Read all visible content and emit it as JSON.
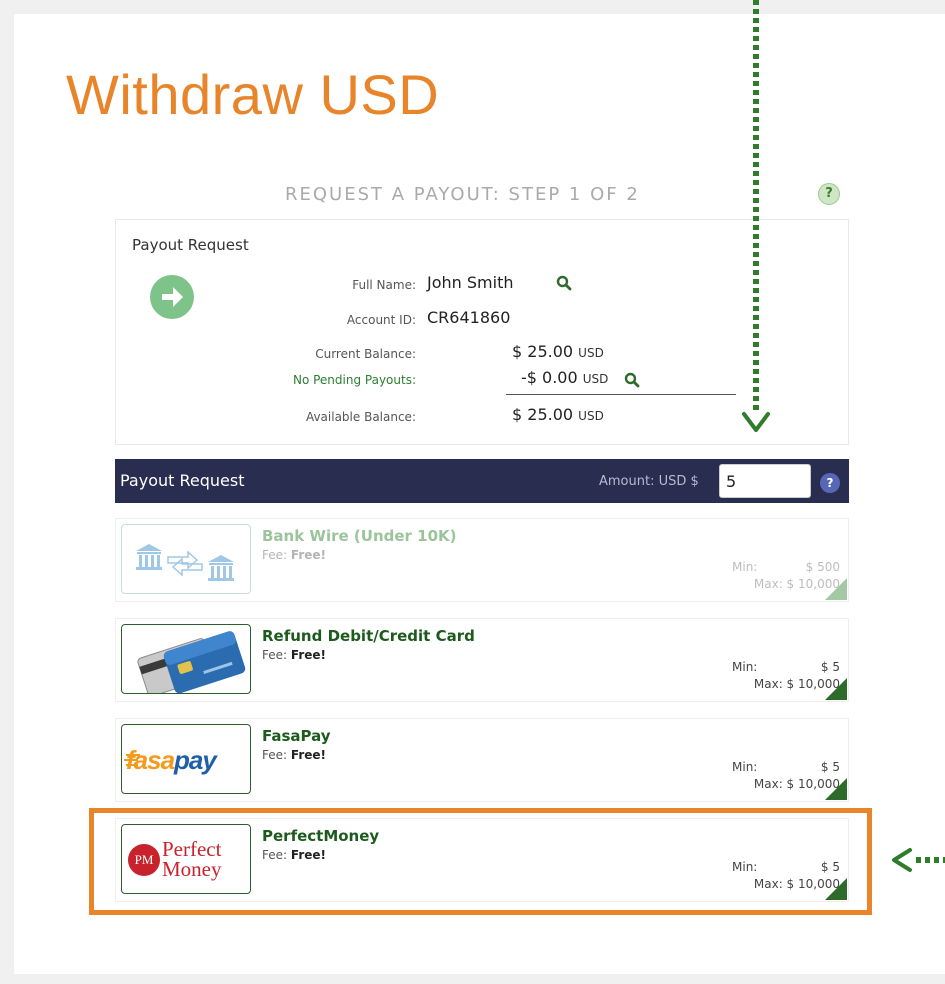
{
  "page": {
    "title": "Withdraw USD",
    "step_label": "REQUEST A PAYOUT: STEP 1 OF 2",
    "help_glyph": "?"
  },
  "summary": {
    "heading": "Payout Request",
    "full_name_label": "Full Name:",
    "full_name": "John Smith",
    "account_id_label": "Account ID:",
    "account_id": "CR641860",
    "current_balance_label": "Current Balance:",
    "current_balance": "$ 25.00",
    "pending_label": "No Pending Payouts:",
    "pending_value": "-$ 0.00",
    "available_label": "Available Balance:",
    "available_balance": "$ 25.00",
    "currency": "USD"
  },
  "payout_bar": {
    "label": "Payout Request",
    "amount_label": "Amount:  USD $",
    "amount_value": "5",
    "help_glyph": "?"
  },
  "methods": [
    {
      "name": "Bank Wire (Under 10K)",
      "fee_label": "Fee:",
      "fee_value": "Free!",
      "min_label": "Min:",
      "min_value": "$ 500",
      "max_label": "Max: $ 10,000",
      "logo": "bank-wire-logo",
      "enabled": false
    },
    {
      "name": "Refund Debit/Credit Card",
      "fee_label": "Fee:",
      "fee_value": "Free!",
      "min_label": "Min:",
      "min_value": "$ 5",
      "max_label": "Max: $ 10,000",
      "logo": "credit-card-logo",
      "enabled": true
    },
    {
      "name": "FasaPay",
      "fee_label": "Fee:",
      "fee_value": "Free!",
      "min_label": "Min:",
      "min_value": "$ 5",
      "max_label": "Max: $ 10,000",
      "logo": "fasapay-logo",
      "logo_text_fasa": "fasa",
      "logo_text_pay": "pay",
      "enabled": true
    },
    {
      "name": "PerfectMoney",
      "fee_label": "Fee:",
      "fee_value": "Free!",
      "min_label": "Min:",
      "min_value": "$ 5",
      "max_label": "Max: $ 10,000",
      "logo": "perfectmoney-logo",
      "logo_badge": "PM",
      "logo_line1": "Perfect",
      "logo_line2": "Money",
      "enabled": true,
      "highlighted": true
    }
  ],
  "colors": {
    "title_orange": "#e8852b",
    "brand_green": "#2e6b2a",
    "bar_navy": "#292d4f",
    "highlight": "#e8852b"
  }
}
